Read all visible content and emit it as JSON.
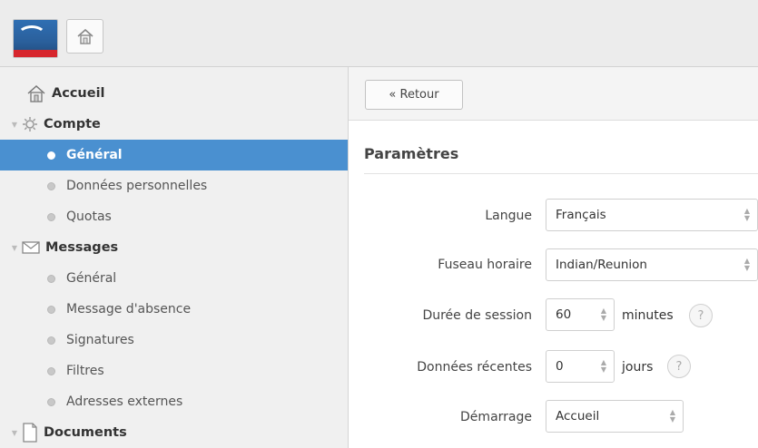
{
  "header": {
    "logo_name": "university-logo",
    "home_icon": "home-icon"
  },
  "sidebar": {
    "items": [
      {
        "label": "Accueil",
        "kind": "section",
        "icon": "home-icon"
      },
      {
        "label": "Compte",
        "kind": "section",
        "icon": "gear-icon"
      },
      {
        "label": "Général",
        "kind": "item",
        "active": true
      },
      {
        "label": "Données personnelles",
        "kind": "item"
      },
      {
        "label": "Quotas",
        "kind": "item"
      },
      {
        "label": "Messages",
        "kind": "section",
        "icon": "envelope-icon"
      },
      {
        "label": "Général",
        "kind": "item"
      },
      {
        "label": "Message d'absence",
        "kind": "item"
      },
      {
        "label": "Signatures",
        "kind": "item"
      },
      {
        "label": "Filtres",
        "kind": "item"
      },
      {
        "label": "Adresses externes",
        "kind": "item"
      },
      {
        "label": "Documents",
        "kind": "section",
        "icon": "document-icon"
      }
    ]
  },
  "main": {
    "back_button": "« Retour",
    "title": "Paramètres",
    "fields": {
      "langue": {
        "label": "Langue",
        "value": "Français"
      },
      "fuseau": {
        "label": "Fuseau horaire",
        "value": "Indian/Reunion"
      },
      "duree": {
        "label": "Durée de session",
        "value": "60",
        "unit": "minutes",
        "help": "?"
      },
      "recentes": {
        "label": "Données récentes",
        "value": "0",
        "unit": "jours",
        "help": "?"
      },
      "demarrage": {
        "label": "Démarrage",
        "value": "Accueil"
      }
    }
  },
  "colors": {
    "active": "#4a90d0",
    "sidebar_bg": "#f0f0f0"
  }
}
